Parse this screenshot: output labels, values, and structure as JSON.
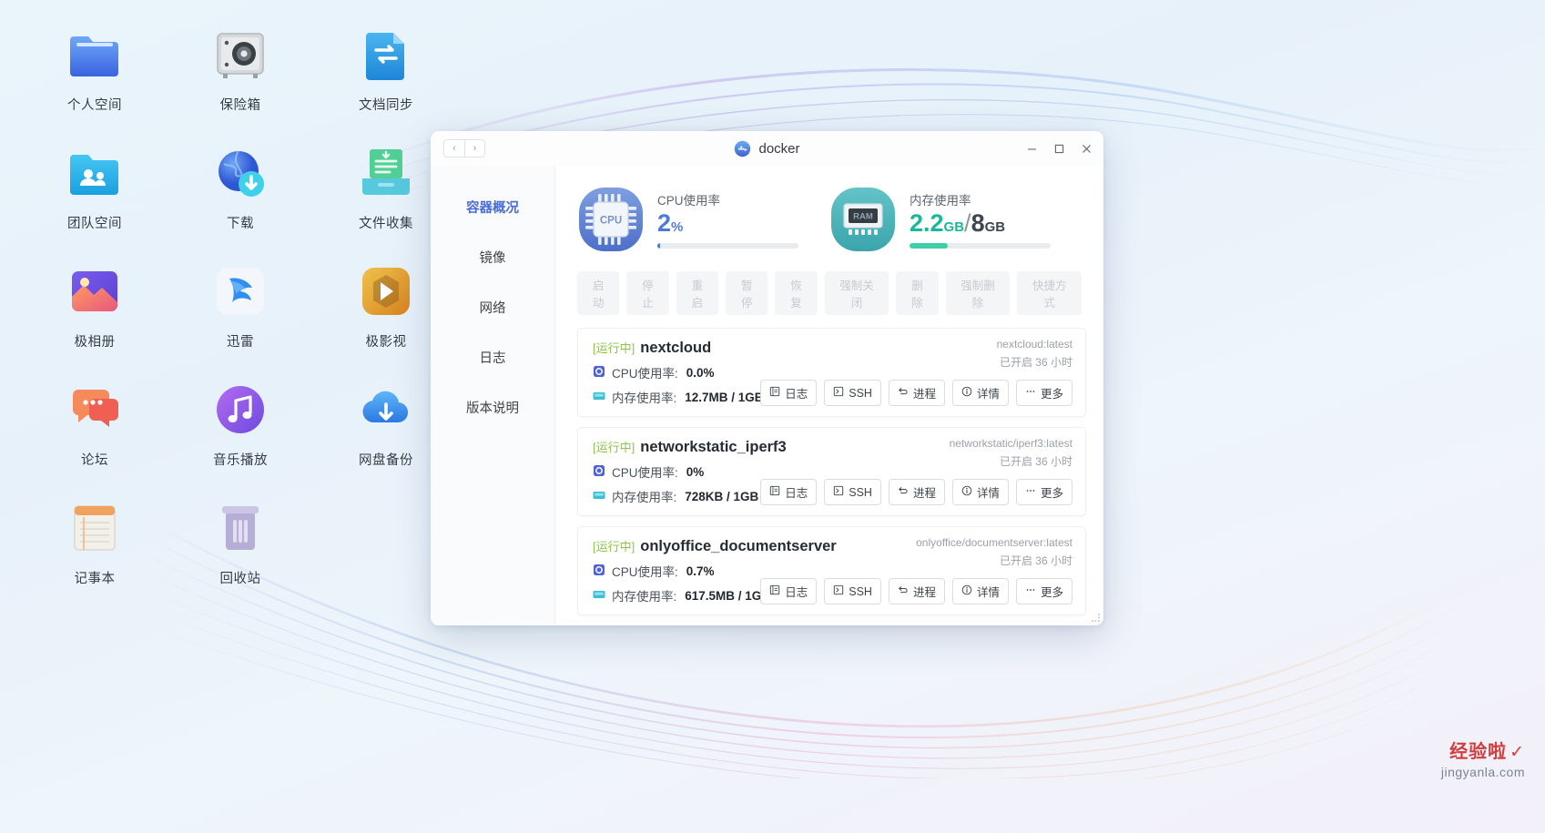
{
  "desktop": {
    "icons": [
      {
        "label": "个人空间",
        "icon": "folder-personal-icon"
      },
      {
        "label": "保险箱",
        "icon": "safe-box-icon"
      },
      {
        "label": "文档同步",
        "icon": "document-sync-icon"
      },
      {
        "label": "团队空间",
        "icon": "folder-team-icon"
      },
      {
        "label": "下载",
        "icon": "globe-download-icon"
      },
      {
        "label": "文件收集",
        "icon": "file-collect-icon"
      },
      {
        "label": "极相册",
        "icon": "photo-album-icon"
      },
      {
        "label": "迅雷",
        "icon": "thunder-bird-icon"
      },
      {
        "label": "极影视",
        "icon": "video-media-icon"
      },
      {
        "label": "论坛",
        "icon": "forum-chat-icon"
      },
      {
        "label": "音乐播放",
        "icon": "music-note-icon"
      },
      {
        "label": "网盘备份",
        "icon": "cloud-backup-icon"
      },
      {
        "label": "记事本",
        "icon": "notebook-icon"
      },
      {
        "label": "回收站",
        "icon": "recycle-bin-icon"
      }
    ]
  },
  "window": {
    "title": "docker",
    "nav": {
      "back": "‹",
      "forward": "›"
    },
    "controls": {
      "minimize": "─",
      "maximize": "□",
      "close": "✕"
    }
  },
  "sidebar": {
    "items": [
      {
        "label": "容器概况",
        "active": true
      },
      {
        "label": "镜像",
        "active": false
      },
      {
        "label": "网络",
        "active": false
      },
      {
        "label": "日志",
        "active": false
      },
      {
        "label": "版本说明",
        "active": false
      }
    ]
  },
  "stats": {
    "cpu": {
      "label": "CPU使用率",
      "value": "2",
      "unit": "%",
      "percent": 2,
      "color": "#4f7bd8",
      "icon": "cpu-chip-icon",
      "icon_text": "CPU"
    },
    "memory": {
      "label": "内存使用率",
      "used": "2.2",
      "used_unit": "GB",
      "separator": "/",
      "total": "8",
      "total_unit": "GB",
      "percent": 27,
      "color": "#3fcfa8",
      "icon": "ram-chip-icon",
      "icon_text": "RAM"
    }
  },
  "toolbar": {
    "buttons": [
      {
        "label": "启动",
        "enabled": false
      },
      {
        "label": "停止",
        "enabled": false
      },
      {
        "label": "重启",
        "enabled": false
      },
      {
        "label": "暂停",
        "enabled": false
      },
      {
        "label": "恢复",
        "enabled": false
      },
      {
        "label": "强制关闭",
        "enabled": false
      },
      {
        "label": "删除",
        "enabled": false
      },
      {
        "label": "强制删除",
        "enabled": false
      },
      {
        "label": "快捷方式",
        "enabled": false
      }
    ]
  },
  "containers": [
    {
      "status": "[运行中]",
      "name": "nextcloud",
      "image": "nextcloud:latest",
      "uptime": "已开启 36 小时",
      "cpu_label": "CPU使用率:",
      "cpu_value": "0.0%",
      "mem_label": "内存使用率:",
      "mem_value": "12.7MB / 1GB",
      "actions": [
        {
          "label": "日志",
          "icon": "log-icon"
        },
        {
          "label": "SSH",
          "icon": "terminal-icon"
        },
        {
          "label": "进程",
          "icon": "process-icon"
        },
        {
          "label": "详情",
          "icon": "info-icon"
        },
        {
          "label": "更多",
          "icon": "more-icon"
        }
      ]
    },
    {
      "status": "[运行中]",
      "name": "networkstatic_iperf3",
      "image": "networkstatic/iperf3:latest",
      "uptime": "已开启 36 小时",
      "cpu_label": "CPU使用率:",
      "cpu_value": "0%",
      "mem_label": "内存使用率:",
      "mem_value": "728KB / 1GB",
      "actions": [
        {
          "label": "日志",
          "icon": "log-icon"
        },
        {
          "label": "SSH",
          "icon": "terminal-icon"
        },
        {
          "label": "进程",
          "icon": "process-icon"
        },
        {
          "label": "详情",
          "icon": "info-icon"
        },
        {
          "label": "更多",
          "icon": "more-icon"
        }
      ]
    },
    {
      "status": "[运行中]",
      "name": "onlyoffice_documentserver",
      "image": "onlyoffice/documentserver:latest",
      "uptime": "已开启 36 小时",
      "cpu_label": "CPU使用率:",
      "cpu_value": "0.7%",
      "mem_label": "内存使用率:",
      "mem_value": "617.5MB / 1GB",
      "actions": [
        {
          "label": "日志",
          "icon": "log-icon"
        },
        {
          "label": "SSH",
          "icon": "terminal-icon"
        },
        {
          "label": "进程",
          "icon": "process-icon"
        },
        {
          "label": "详情",
          "icon": "info-icon"
        },
        {
          "label": "更多",
          "icon": "more-icon"
        }
      ]
    }
  ],
  "watermark": {
    "main": "经验啦",
    "check": "✓",
    "sub": "jingyanla.com"
  }
}
